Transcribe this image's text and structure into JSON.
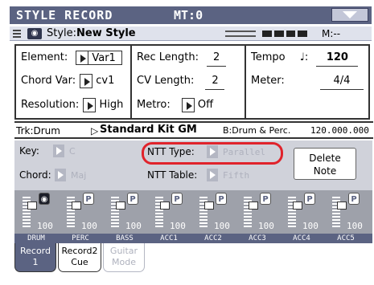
{
  "header": {
    "title": "STYLE RECORD",
    "mt": "MT:0",
    "menu_icon": "triangle-down-icon"
  },
  "style_line": {
    "label": "Style:",
    "name": "New Style",
    "measure_label": "M:--"
  },
  "params": {
    "element_label": "Element:",
    "element_value": "Var1",
    "chord_var_label": "Chord Var:",
    "chord_var_value": "cv1",
    "resolution_label": "Resolution:",
    "resolution_value": "High",
    "rec_length_label": "Rec Length:",
    "rec_length_value": "2",
    "cv_length_label": "CV Length:",
    "cv_length_value": "2",
    "metro_label": "Metro:",
    "metro_value": "Off",
    "tempo_label": "Tempo",
    "tempo_note": "♩:",
    "tempo_value": "120",
    "meter_label": "Meter:",
    "meter_value": "4/4"
  },
  "track": {
    "trk": "Trk:Drum",
    "kit": "Standard Kit GM",
    "bank": "B:Drum & Perc.",
    "prog": "120.000.000"
  },
  "trigger": {
    "key_label": "Key:",
    "key_value": "C",
    "chord_label": "Chord:",
    "chord_value": "Maj",
    "ntt_type_label": "NTT Type:",
    "ntt_type_value": "Parallel",
    "ntt_table_label": "NTT Table:",
    "ntt_table_value": "Fifth",
    "delete_line1": "Delete",
    "delete_line2": "Note"
  },
  "channels": [
    {
      "label": "DRUM",
      "vol": "100",
      "badge": "record-icon"
    },
    {
      "label": "PERC",
      "vol": "100",
      "badge": "P"
    },
    {
      "label": "BASS",
      "vol": "100",
      "badge": "P"
    },
    {
      "label": "ACC1",
      "vol": "100",
      "badge": "P"
    },
    {
      "label": "ACC2",
      "vol": "100",
      "badge": "P"
    },
    {
      "label": "ACC3",
      "vol": "100",
      "badge": "P"
    },
    {
      "label": "ACC4",
      "vol": "100",
      "badge": "P"
    },
    {
      "label": "ACC5",
      "vol": "100",
      "badge": "P"
    }
  ],
  "tabs": [
    {
      "line1": "Record",
      "line2": "1"
    },
    {
      "line1": "Record2",
      "line2": "Cue"
    },
    {
      "line1": "Guitar",
      "line2": "Mode"
    }
  ]
}
